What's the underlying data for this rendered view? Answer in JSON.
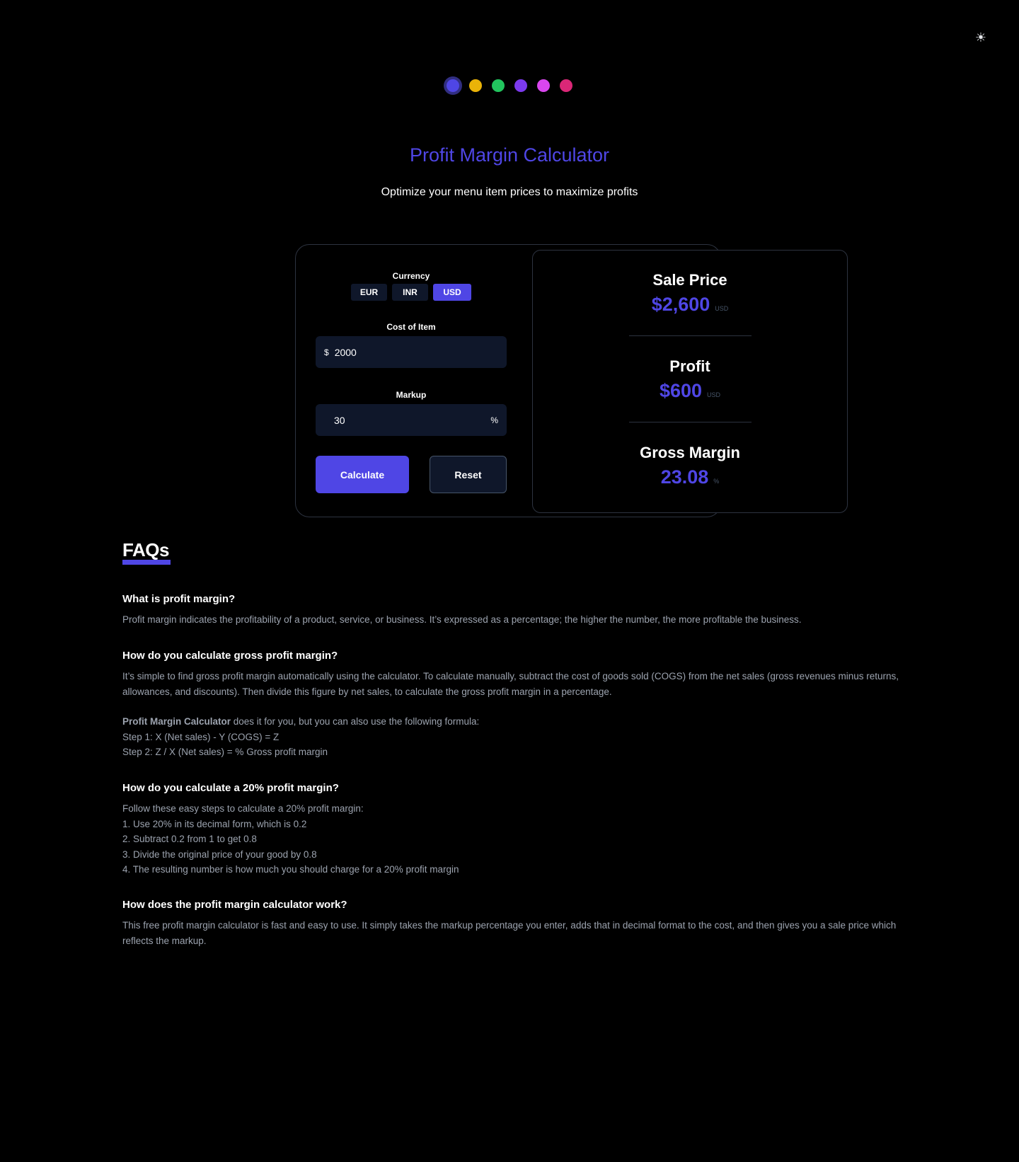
{
  "theme_toggle": {
    "icon": "sun-icon",
    "glyph": "☀"
  },
  "color_options": [
    {
      "name": "indigo",
      "color": "#4f46e5",
      "selected": true
    },
    {
      "name": "amber",
      "color": "#eab308",
      "selected": false
    },
    {
      "name": "green",
      "color": "#22c55e",
      "selected": false
    },
    {
      "name": "violet",
      "color": "#7c3aed",
      "selected": false
    },
    {
      "name": "fuchsia",
      "color": "#d946ef",
      "selected": false
    },
    {
      "name": "pink",
      "color": "#db2777",
      "selected": false
    }
  ],
  "hero": {
    "title": "Profit Margin Calculator",
    "subtitle": "Optimize your menu item prices to maximize profits"
  },
  "calculator": {
    "currency_label": "Currency",
    "currencies": [
      "EUR",
      "INR",
      "USD"
    ],
    "selected_currency": "USD",
    "cost_label": "Cost of Item",
    "cost_prefix": "$",
    "cost_value": "2000",
    "markup_label": "Markup",
    "markup_value": "30",
    "markup_suffix": "%",
    "calculate_label": "Calculate",
    "reset_label": "Reset"
  },
  "results": {
    "sale_price": {
      "title": "Sale Price",
      "value": "$2,600",
      "unit": "USD"
    },
    "profit": {
      "title": "Profit",
      "value": "$600",
      "unit": "USD"
    },
    "gross_margin": {
      "title": "Gross Margin",
      "value": "23.08",
      "unit": "%"
    }
  },
  "faqs": {
    "heading": "FAQs",
    "q1": {
      "question": "What is profit margin?",
      "answer": "Profit margin indicates the profitability of a product, service, or business. It’s expressed as a percentage; the higher the number, the more profitable the business."
    },
    "q2": {
      "question": "How do you calculate gross profit margin?",
      "answer_p1": "It’s simple to find gross profit margin automatically using the calculator. To calculate manually, subtract the cost of goods sold (COGS) from the net sales (gross revenues minus returns, allowances, and discounts). Then divide this figure by net sales, to calculate the gross profit margin in a percentage.",
      "answer_bold": "Profit Margin Calculator",
      "answer_p2": " does it for you, but you can also use the following formula:",
      "step1": "Step 1: X (Net sales) - Y (COGS) = Z",
      "step2": "Step 2: Z / X (Net sales) = % Gross profit margin"
    },
    "q3": {
      "question": "How do you calculate a 20% profit margin?",
      "intro": "Follow these easy steps to calculate a 20% profit margin:",
      "steps": [
        "1. Use 20% in its decimal form, which is 0.2",
        "2. Subtract 0.2 from 1 to get 0.8",
        "3. Divide the original price of your good by 0.8",
        "4. The resulting number is how much you should charge for a 20% profit margin"
      ]
    },
    "q4": {
      "question": "How does the profit margin calculator work?",
      "answer": "This free profit margin calculator is fast and easy to use. It simply takes the markup percentage you enter, adds that in decimal format to the cost, and then gives you a sale price which reflects the markup."
    }
  }
}
